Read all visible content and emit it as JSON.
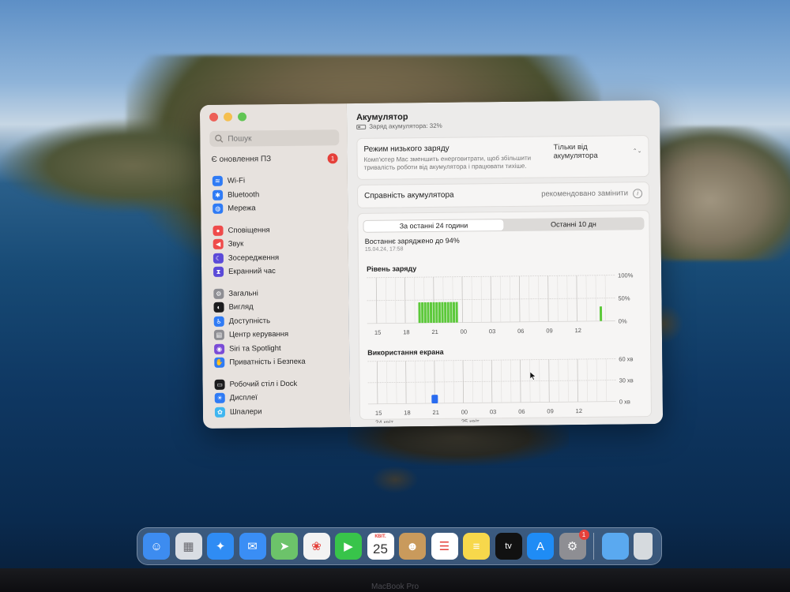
{
  "sidebar": {
    "search_placeholder": "Пошук",
    "update_label": "Є оновлення ПЗ",
    "update_count": "1",
    "groups": [
      [
        {
          "label": "Wi-Fi",
          "icon": "wifi-icon",
          "color": "#2f7bf5",
          "glyph": "≋"
        },
        {
          "label": "Bluetooth",
          "icon": "bluetooth-icon",
          "color": "#2f7bf5",
          "glyph": "✱"
        },
        {
          "label": "Мережа",
          "icon": "globe-icon",
          "color": "#2f7bf5",
          "glyph": "◍"
        }
      ],
      [
        {
          "label": "Сповіщення",
          "icon": "bell-icon",
          "color": "#ef4b4b",
          "glyph": "●"
        },
        {
          "label": "Звук",
          "icon": "speaker-icon",
          "color": "#ef4b4b",
          "glyph": "◀"
        },
        {
          "label": "Зосередження",
          "icon": "moon-icon",
          "color": "#5b4ad8",
          "glyph": "☾"
        },
        {
          "label": "Екранний час",
          "icon": "hourglass-icon",
          "color": "#5b4ad8",
          "glyph": "⧗"
        }
      ],
      [
        {
          "label": "Загальні",
          "icon": "gear-icon",
          "color": "#8e8e93",
          "glyph": "⚙"
        },
        {
          "label": "Вигляд",
          "icon": "appearance-icon",
          "color": "#1c1c1e",
          "glyph": "◐"
        },
        {
          "label": "Доступність",
          "icon": "accessibility-icon",
          "color": "#2f7bf5",
          "glyph": "♿"
        },
        {
          "label": "Центр керування",
          "icon": "control-center-icon",
          "color": "#8e8e93",
          "glyph": "▤"
        },
        {
          "label": "Siri та Spotlight",
          "icon": "siri-icon",
          "color": "#7a4bd6",
          "glyph": "◉"
        },
        {
          "label": "Приватність і Безпека",
          "icon": "hand-icon",
          "color": "#2f7bf5",
          "glyph": "✋"
        }
      ],
      [
        {
          "label": "Робочий стіл і Dock",
          "icon": "desktop-dock-icon",
          "color": "#1c1c1e",
          "glyph": "▭"
        },
        {
          "label": "Дисплеї",
          "icon": "sun-icon",
          "color": "#2f7bf5",
          "glyph": "☀"
        },
        {
          "label": "Шпалери",
          "icon": "wallpaper-icon",
          "color": "#3fb6f0",
          "glyph": "✿"
        }
      ]
    ]
  },
  "main": {
    "title": "Акумулятор",
    "subtitle": "Заряд акумулятора: 32%",
    "low_power": {
      "label": "Режим низького заряду",
      "description": "Комп'ютер Mac зменшить енерговитрати, щоб збільшити тривалість роботи від акумулятора і працювати тихіше.",
      "value": "Тільки від акумулятора"
    },
    "health": {
      "label": "Справність акумулятора",
      "value": "рекомендовано замінити"
    },
    "tabs": [
      "За останні 24 години",
      "Останні 10 дн"
    ],
    "active_tab": 0,
    "last_charged": "Востаннє заряджено до 94%",
    "last_charged_date": "15.04.24, 17:58"
  },
  "chart_data": [
    {
      "type": "bar",
      "title": "Рівень заряду",
      "x_ticks": [
        "15",
        "18",
        "21",
        "00",
        "03",
        "06",
        "09",
        "12"
      ],
      "y_ticks": [
        "100%",
        "50%",
        "0%"
      ],
      "ylim": [
        0,
        100
      ],
      "color": "#5cc93a",
      "bars": [
        {
          "x": 19.5,
          "value": 45
        },
        {
          "x": 19.8,
          "value": 45
        },
        {
          "x": 20.1,
          "value": 45
        },
        {
          "x": 20.4,
          "value": 45
        },
        {
          "x": 20.7,
          "value": 45
        },
        {
          "x": 21.0,
          "value": 45
        },
        {
          "x": 21.3,
          "value": 45
        },
        {
          "x": 21.6,
          "value": 45
        },
        {
          "x": 21.9,
          "value": 45
        },
        {
          "x": 22.2,
          "value": 45
        },
        {
          "x": 22.5,
          "value": 45
        },
        {
          "x": 22.8,
          "value": 45
        },
        {
          "x": 23.1,
          "value": 45
        },
        {
          "x": 23.4,
          "value": 45
        },
        {
          "x": 38.5,
          "value": 32
        }
      ]
    },
    {
      "type": "bar",
      "title": "Використання екрана",
      "x_ticks": [
        "15",
        "18",
        "21",
        "00",
        "03",
        "06",
        "09",
        "12"
      ],
      "x_dates": [
        {
          "label": "24 квіт.",
          "x": 15
        },
        {
          "label": "25 квіт.",
          "x": 24
        }
      ],
      "y_ticks": [
        "60 хв",
        "30 хв",
        "0 хв"
      ],
      "ylim": [
        0,
        60
      ],
      "color": "#2a6cf0",
      "bars": [
        {
          "x": 21,
          "value": 12
        }
      ]
    }
  ],
  "dock": {
    "apps": [
      {
        "name": "finder",
        "icon": "finder-icon",
        "color": "#3d8cf0",
        "glyph": "☺"
      },
      {
        "name": "launchpad",
        "icon": "launchpad-icon",
        "color": "#d9dde3",
        "glyph": "▦"
      },
      {
        "name": "safari",
        "icon": "safari-icon",
        "color": "#2f8cf4",
        "glyph": "✦"
      },
      {
        "name": "mail",
        "icon": "mail-icon",
        "color": "#3a8ef5",
        "glyph": "✉"
      },
      {
        "name": "maps",
        "icon": "maps-icon",
        "color": "#6cc36a",
        "glyph": "➤"
      },
      {
        "name": "photos",
        "icon": "photos-icon",
        "color": "#f3f3f3",
        "glyph": "❀"
      },
      {
        "name": "facetime",
        "icon": "facetime-icon",
        "color": "#38c44a",
        "glyph": "▶"
      },
      {
        "name": "calendar",
        "icon": "calendar-icon",
        "color": "#ffffff",
        "glyph": ""
      },
      {
        "name": "contacts",
        "icon": "contacts-icon",
        "color": "#c99a5c",
        "glyph": "☻"
      },
      {
        "name": "reminders",
        "icon": "reminders-icon",
        "color": "#ffffff",
        "glyph": "☰"
      },
      {
        "name": "notes",
        "icon": "notes-icon",
        "color": "#f7d84b",
        "glyph": "≡"
      },
      {
        "name": "tv",
        "icon": "apple-tv-icon",
        "color": "#111111",
        "glyph": "tv"
      },
      {
        "name": "app-store",
        "icon": "app-store-icon",
        "color": "#1f8cf5",
        "glyph": "A"
      },
      {
        "name": "system-settings",
        "icon": "system-settings-icon",
        "color": "#8e8e93",
        "glyph": "⚙"
      }
    ],
    "calendar_month": "КВІТ.",
    "calendar_day": "25",
    "settings_badge": "1",
    "downloads_color": "#5aa9f0",
    "trash_color": "#d6dade"
  },
  "bezel_label": "MacBook Pro"
}
